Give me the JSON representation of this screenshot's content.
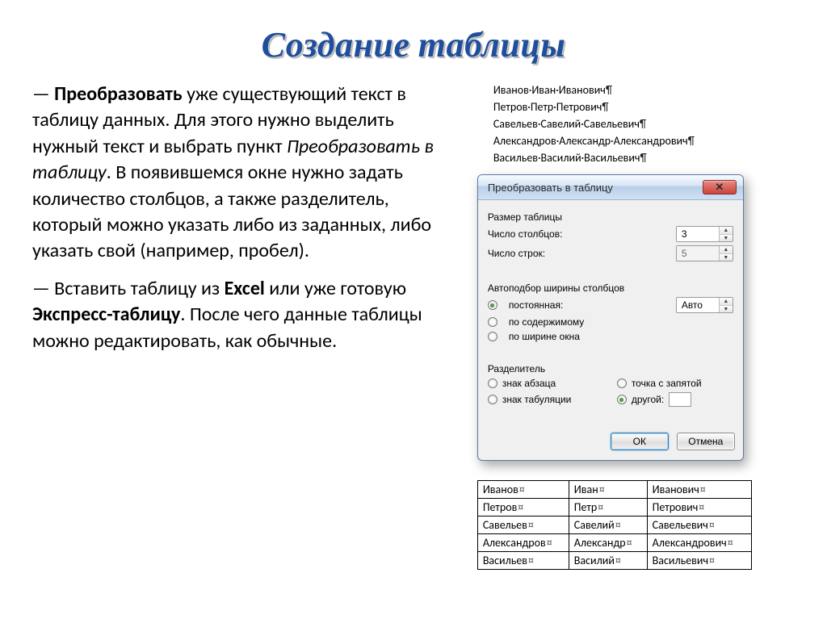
{
  "title": "Создание таблицы",
  "para1_lead": "— ",
  "para1_bold": "Преобразовать",
  "para1_rest1": " уже существующий текст в таблицу данных. Для этого нужно выделить нужный текст и выбрать пункт ",
  "para1_italic": "Преобразовать в таблицу",
  "para1_rest2": ". В появившемся окне нужно задать количество столбцов, а также разделитель, который  можно указать либо из заданных, либо указать свой (например, пробел).",
  "para2_lead": "— Вставить таблицу из ",
  "para2_bold1": "Excel",
  "para2_mid": " или уже готовую ",
  "para2_bold2": "Экспресс-таблицу",
  "para2_rest": ". После чего данные таблицы можно редактировать, как обычные.",
  "names": [
    "Иванов·Иван·Иванович",
    "Петров·Петр·Петрович",
    "Савельев·Савелий·Савельевич",
    "Александров·Александр·Александрович",
    "Васильев·Василий·Васильевич"
  ],
  "dialog": {
    "title": "Преобразовать в таблицу",
    "size_group": "Размер таблицы",
    "cols_label": "Число столбцов:",
    "cols_value": "3",
    "rows_label": "Число строк:",
    "rows_value": "5",
    "autofit_group": "Автоподбор ширины столбцов",
    "fixed_label": "постоянная:",
    "fixed_value": "Авто",
    "bycontent_label": "по содержимому",
    "bywindow_label": "по ширине окна",
    "sep_group": "Разделитель",
    "sep_para": "знак абзаца",
    "sep_semi": "точка с запятой",
    "sep_tab": "знак табуляции",
    "sep_other": "другой:",
    "ok": "ОК",
    "cancel": "Отмена"
  },
  "result": [
    [
      "Иванов",
      "Иван",
      "Иванович"
    ],
    [
      "Петров",
      "Петр",
      "Петрович"
    ],
    [
      "Савельев",
      "Савелий",
      "Савельевич"
    ],
    [
      "Александров",
      "Александр",
      "Александрович"
    ],
    [
      "Васильев",
      "Василий",
      "Васильевич"
    ]
  ]
}
